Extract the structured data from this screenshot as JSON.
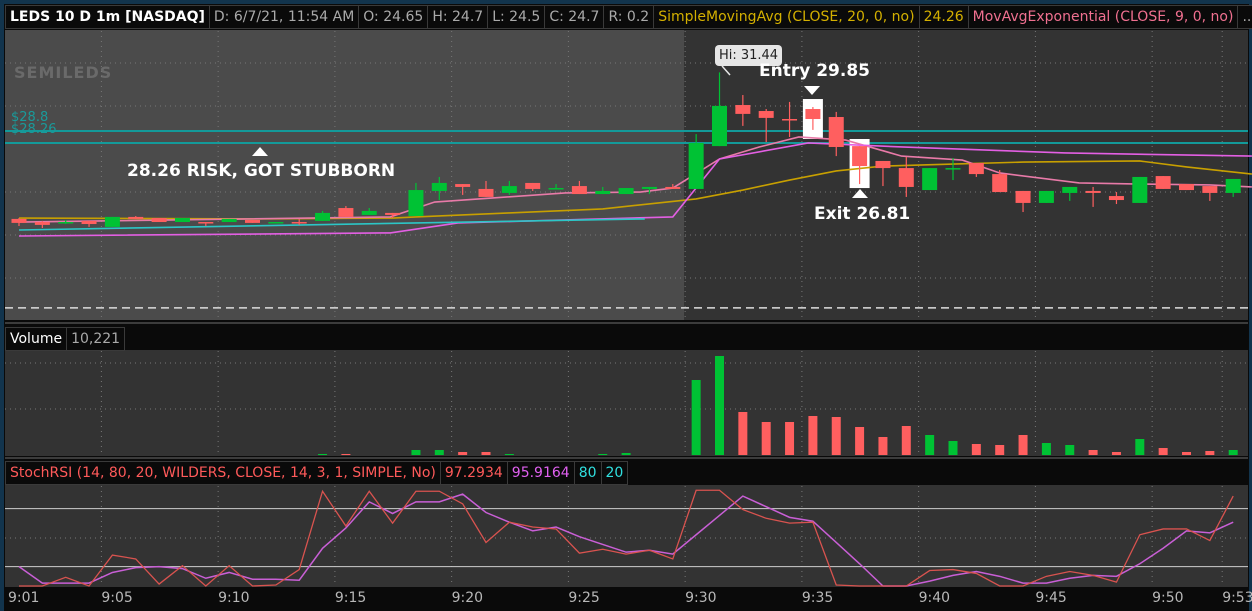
{
  "header": {
    "symbol": "LEDS 10 D 1m [NASDAQ]",
    "date": "D: 6/7/21, 11:54 AM",
    "open": "O: 24.65",
    "high": "H: 24.7",
    "low": "L: 24.5",
    "close": "C: 24.7",
    "range": "R: 0.2",
    "sma_label": "SimpleMovingAvg (CLOSE, 20, 0, no)",
    "sma_value": "24.26",
    "ema_label": "MovAvgExponential (CLOSE, 9, 0, no)",
    "more": "..."
  },
  "logo_text": "SEMILEDS",
  "volume_header": {
    "label": "Volume",
    "value": "10,221"
  },
  "stoch_header": {
    "label": "StochRSI (14, 80, 20, WILDERS, CLOSE, 14, 3, 1, SIMPLE, No)",
    "k_value": "97.2934",
    "d_value": "95.9164",
    "upper": "80",
    "lower": "20"
  },
  "annotations": {
    "risk": "28.26 RISK, GOT STUBBORN",
    "entry": "Entry 29.85",
    "exit": "Exit 26.81",
    "hi": "Hi: 31.44"
  },
  "levels": {
    "upper_label": "$28.8",
    "lower_label": "$28.26"
  },
  "colors": {
    "up": "#00c234",
    "down": "#ff5f5f",
    "sma": "#c8a000",
    "ema": "#e87aa8",
    "line3": "#e35fe3",
    "line4": "#2cc6c6",
    "level": "#139a9a",
    "stoch_k": "#d9534f",
    "stoch_d": "#c95fd6"
  },
  "chart_data": {
    "type": "candlestick",
    "title": "LEDS 10 D 1m [NASDAQ]",
    "x": [
      "9:01",
      "9:02",
      "9:03",
      "9:04",
      "9:05",
      "9:06",
      "9:07",
      "9:08",
      "9:09",
      "9:10",
      "9:11",
      "9:12",
      "9:13",
      "9:14",
      "9:15",
      "9:16",
      "9:17",
      "9:18",
      "9:19",
      "9:20",
      "9:21",
      "9:22",
      "9:23",
      "9:24",
      "9:25",
      "9:26",
      "9:27",
      "9:28",
      "9:29",
      "9:30",
      "9:31",
      "9:32",
      "9:33",
      "9:34",
      "9:35",
      "9:36",
      "9:37",
      "9:38",
      "9:39",
      "9:40",
      "9:41",
      "9:42",
      "9:43",
      "9:44",
      "9:45",
      "9:46",
      "9:47",
      "9:48",
      "9:49",
      "9:50",
      "9:51",
      "9:52",
      "9:53"
    ],
    "x_tick_labels": [
      "9:01",
      "9:05",
      "9:10",
      "9:15",
      "9:20",
      "9:25",
      "9:30",
      "9:35",
      "9:40",
      "9:45",
      "9:50",
      "9:53"
    ],
    "ohlc": [
      [
        24.84,
        24.88,
        24.52,
        24.66
      ],
      [
        24.7,
        24.75,
        24.43,
        24.57
      ],
      [
        24.7,
        24.79,
        24.61,
        24.7
      ],
      [
        24.75,
        24.75,
        24.48,
        24.61
      ],
      [
        24.48,
        24.93,
        24.48,
        24.93
      ],
      [
        24.93,
        24.97,
        24.84,
        24.84
      ],
      [
        24.88,
        24.88,
        24.7,
        24.7
      ],
      [
        24.7,
        24.88,
        24.7,
        24.88
      ],
      [
        24.7,
        24.7,
        24.52,
        24.66
      ],
      [
        24.7,
        24.84,
        24.7,
        24.84
      ],
      [
        24.79,
        24.79,
        24.66,
        24.66
      ],
      [
        24.66,
        24.7,
        24.66,
        24.7
      ],
      [
        24.7,
        24.84,
        24.57,
        24.68
      ],
      [
        24.75,
        25.2,
        24.75,
        25.11
      ],
      [
        25.33,
        25.42,
        24.93,
        24.93
      ],
      [
        25.02,
        25.33,
        25.02,
        25.2
      ],
      [
        25.11,
        25.11,
        24.88,
        25.02
      ],
      [
        24.97,
        26.46,
        24.97,
        26.14
      ],
      [
        26.1,
        26.73,
        25.69,
        26.46
      ],
      [
        26.41,
        26.41,
        25.92,
        26.28
      ],
      [
        26.19,
        26.55,
        25.83,
        25.83
      ],
      [
        26.01,
        26.55,
        25.92,
        26.32
      ],
      [
        26.46,
        26.46,
        26.1,
        26.19
      ],
      [
        26.21,
        26.41,
        26.19,
        26.23
      ],
      [
        26.32,
        26.55,
        25.96,
        25.96
      ],
      [
        25.96,
        26.28,
        25.96,
        26.1
      ],
      [
        25.96,
        26.23,
        25.96,
        26.23
      ],
      [
        26.19,
        26.28,
        25.96,
        26.28
      ],
      [
        26.28,
        26.41,
        26.19,
        26.19
      ],
      [
        26.19,
        28.66,
        26.19,
        28.26
      ],
      [
        28.12,
        31.44,
        28.12,
        29.93
      ],
      [
        29.97,
        30.42,
        29.03,
        29.57
      ],
      [
        29.7,
        29.79,
        28.3,
        29.39
      ],
      [
        29.34,
        30.11,
        28.53,
        29.3
      ],
      [
        29.79,
        29.88,
        28.85,
        29.34
      ],
      [
        29.43,
        29.66,
        27.67,
        28.08
      ],
      [
        28.12,
        28.12,
        26.41,
        27.22
      ],
      [
        27.45,
        27.45,
        26.32,
        27.13
      ],
      [
        27.13,
        27.63,
        25.83,
        26.28
      ],
      [
        26.14,
        27.13,
        26.14,
        27.13
      ],
      [
        27.1,
        27.58,
        26.59,
        27.13
      ],
      [
        27.36,
        27.36,
        26.73,
        26.86
      ],
      [
        26.86,
        27.04,
        26.05,
        26.05
      ],
      [
        26.1,
        26.1,
        25.15,
        25.56
      ],
      [
        25.56,
        26.1,
        25.56,
        26.1
      ],
      [
        26.01,
        26.28,
        25.65,
        26.28
      ],
      [
        26.1,
        26.28,
        25.38,
        26.01
      ],
      [
        25.87,
        26.05,
        25.51,
        25.69
      ],
      [
        25.56,
        26.73,
        25.56,
        26.73
      ],
      [
        26.77,
        26.77,
        26.19,
        26.19
      ],
      [
        26.41,
        26.41,
        26.14,
        26.14
      ],
      [
        26.32,
        26.32,
        25.65,
        26.01
      ],
      [
        26.01,
        26.64,
        25.83,
        26.64
      ]
    ],
    "ylim": [
      20.5,
      33.0
    ],
    "overlays": [
      {
        "name": "SimpleMovingAvg 20",
        "color_key": "sma",
        "points": [
          [
            0,
            24.88
          ],
          [
            10,
            24.84
          ],
          [
            16,
            24.88
          ],
          [
            17,
            24.93
          ],
          [
            21,
            25.11
          ],
          [
            25,
            25.29
          ],
          [
            29,
            25.74
          ],
          [
            31,
            26.14
          ],
          [
            33,
            26.59
          ],
          [
            35,
            27.0
          ],
          [
            37,
            27.22
          ],
          [
            40,
            27.31
          ],
          [
            43,
            27.4
          ],
          [
            48,
            27.45
          ],
          [
            50,
            27.18
          ],
          [
            52.8,
            26.86
          ]
        ]
      },
      {
        "name": "MovAvgExponential 9",
        "color_key": "ema",
        "points": [
          [
            0,
            24.7
          ],
          [
            15.9,
            24.93
          ],
          [
            17.8,
            25.6
          ],
          [
            23.4,
            26.01
          ],
          [
            26.6,
            26.05
          ],
          [
            28,
            26.23
          ],
          [
            30,
            27.54
          ],
          [
            31.7,
            28.08
          ],
          [
            33.4,
            28.53
          ],
          [
            35.4,
            28.39
          ],
          [
            37.8,
            27.67
          ],
          [
            40.4,
            27.49
          ],
          [
            42,
            26.91
          ],
          [
            45.4,
            26.46
          ],
          [
            48,
            26.41
          ],
          [
            51,
            26.37
          ],
          [
            52.8,
            26.28
          ]
        ]
      },
      {
        "name": "line3",
        "color_key": "line3",
        "points": [
          [
            0,
            24.07
          ],
          [
            15.9,
            24.21
          ],
          [
            18.8,
            24.66
          ],
          [
            28,
            24.93
          ],
          [
            30,
            27.54
          ],
          [
            33.8,
            28.26
          ],
          [
            37.8,
            28.08
          ],
          [
            44.8,
            27.81
          ],
          [
            52.8,
            27.67
          ]
        ]
      },
      {
        "name": "line4",
        "color_key": "line4",
        "points": [
          [
            0,
            24.34
          ],
          [
            26.8,
            24.84
          ]
        ]
      }
    ],
    "horizontal_levels": [
      28.8,
      28.26
    ],
    "dashed_level": 20.83,
    "entry_price": 29.85,
    "exit_price": 26.81,
    "entry_index": 34,
    "exit_index": 36,
    "premarket_until_index": 28.5,
    "volume": {
      "values": [
        0,
        0,
        0,
        0,
        0,
        0,
        0,
        0,
        0,
        0,
        0,
        0,
        0,
        1,
        1,
        0,
        0,
        5,
        5,
        3,
        3,
        1,
        0,
        0,
        0,
        1,
        2,
        0,
        0,
        75,
        99,
        43,
        33,
        33,
        39,
        38,
        28,
        18,
        29,
        20,
        14,
        11,
        10,
        20,
        12,
        10,
        5,
        3,
        16,
        7,
        3,
        4,
        5
      ],
      "ylim": [
        0,
        105
      ]
    },
    "stoch_rsi": {
      "k": [
        0,
        0,
        9,
        0,
        32,
        28,
        2,
        21,
        0,
        21,
        0,
        1,
        17,
        98,
        62,
        98,
        65,
        98,
        98,
        85,
        45,
        66,
        61,
        59,
        34,
        38,
        33,
        37,
        28,
        99,
        99,
        79,
        70,
        65,
        66,
        1,
        0,
        0,
        0,
        16,
        17,
        13,
        0,
        0,
        10,
        15,
        11,
        4,
        53,
        59,
        59,
        47,
        93
      ],
      "d": [
        20,
        3,
        3,
        3,
        14,
        19,
        20,
        18,
        8,
        14,
        7,
        7,
        6,
        39,
        60,
        87,
        75,
        87,
        87,
        95,
        76,
        66,
        57,
        61,
        51,
        43,
        35,
        37,
        33,
        53,
        73,
        93,
        82,
        71,
        67,
        45,
        23,
        0,
        0,
        5,
        11,
        15,
        10,
        3,
        3,
        8,
        11,
        10,
        23,
        39,
        57,
        55,
        66
      ],
      "upper": 80,
      "lower": 20,
      "ylim": [
        0,
        100
      ]
    }
  }
}
